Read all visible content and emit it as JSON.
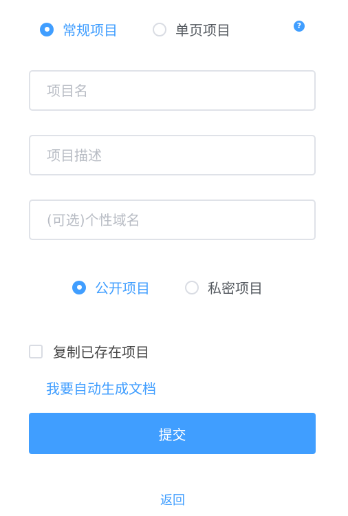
{
  "project_type": {
    "options": [
      {
        "label": "常规项目",
        "checked": true
      },
      {
        "label": "单页项目",
        "checked": false
      }
    ],
    "help_icon": "?"
  },
  "fields": {
    "project_name": {
      "placeholder": "项目名",
      "value": ""
    },
    "project_description": {
      "placeholder": "项目描述",
      "value": ""
    },
    "custom_domain": {
      "placeholder": "(可选)个性域名",
      "value": ""
    }
  },
  "visibility": {
    "options": [
      {
        "label": "公开项目",
        "checked": true
      },
      {
        "label": "私密项目",
        "checked": false
      }
    ]
  },
  "copy_existing": {
    "label": "复制已存在项目",
    "checked": false
  },
  "auto_generate_link": "我要自动生成文档",
  "submit_label": "提交",
  "back_label": "返回",
  "colors": {
    "accent": "#409eff",
    "border": "#dfe2e8",
    "placeholder": "#b8bcc4",
    "text": "#555a60"
  }
}
